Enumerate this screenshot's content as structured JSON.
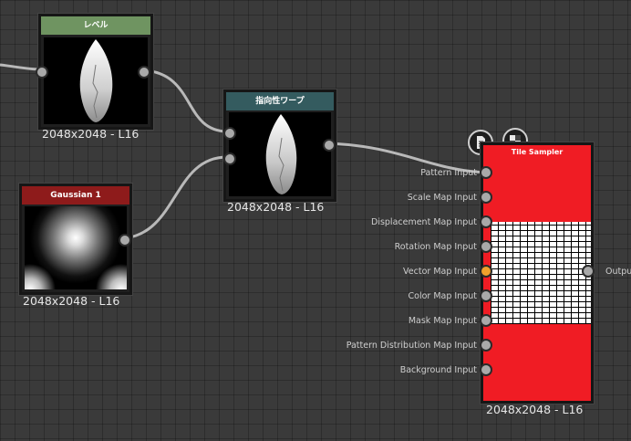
{
  "nodes": {
    "level": {
      "title": "レベル",
      "caption": "2048x2048 - L16",
      "header_color": "#6f9461"
    },
    "warp": {
      "title": "指向性ワープ",
      "caption": "2048x2048 - L16",
      "header_color": "#345b5f"
    },
    "gaussian": {
      "title": "Gaussian 1",
      "caption": "2048x2048 - L16",
      "header_color": "#8e1b1b"
    },
    "tile_sampler": {
      "title": "Tile Sampler",
      "caption": "2048x2048 - L16",
      "body_color": "#f01c24",
      "inputs": [
        "Pattern Input",
        "Scale Map Input",
        "Displacement Map Input",
        "Rotation Map Input",
        "Vector Map Input",
        "Color Map Input",
        "Mask Map Input",
        "Pattern Distribution Map Input",
        "Background Input"
      ],
      "active_input": "Vector Map Input",
      "output_label": "Output",
      "toolbar_icons": [
        "document-icon",
        "checker-icon"
      ]
    }
  },
  "colors": {
    "wire": "#b9b9b9",
    "active_port": "#f0a12c",
    "port": "#a9a9a9"
  }
}
